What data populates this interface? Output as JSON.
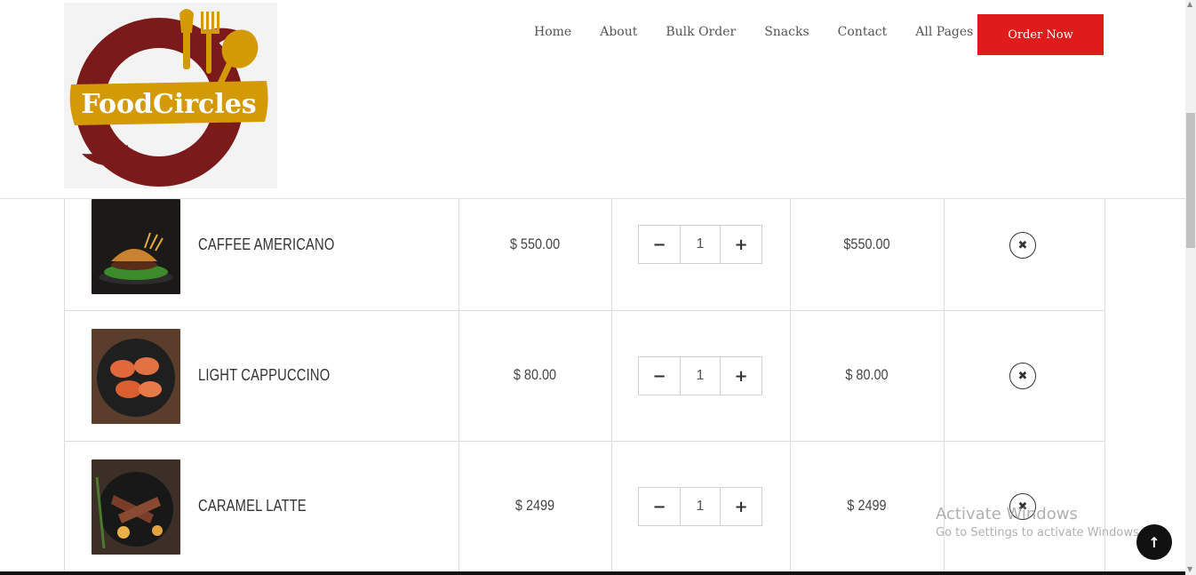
{
  "brand": {
    "logo_text": "FoodCircles",
    "colors": {
      "ring": "#7a1a1a",
      "gold": "#d39a06",
      "logo_bg": "#f3f3f3"
    }
  },
  "nav": {
    "items": [
      "Home",
      "About",
      "Bulk Order",
      "Snacks",
      "Contact",
      "All Pages"
    ],
    "cta_label": "Order Now",
    "cta_color": "#e01b1b"
  },
  "cart": {
    "items": [
      {
        "name": "CAFFEE AMERICANO",
        "price": "$ 550.00",
        "quantity": "1",
        "subtotal": "$550.00",
        "image_icon": "burger-photo"
      },
      {
        "name": "LIGHT CAPPUCCINO",
        "price": "$ 80.00",
        "quantity": "1",
        "subtotal": "$ 80.00",
        "image_icon": "chicken-pan-photo"
      },
      {
        "name": "CARAMEL LATTE",
        "price": "$ 2499",
        "quantity": "1",
        "subtotal": "$ 2499",
        "image_icon": "lamb-chops-photo"
      }
    ],
    "decrement_symbol": "−",
    "increment_symbol": "+",
    "remove_symbol": "✖"
  },
  "overlay": {
    "activate_title": "Activate Windows",
    "activate_subtitle": "Go to Settings to activate Windows.",
    "back_to_top_symbol": "↑"
  }
}
